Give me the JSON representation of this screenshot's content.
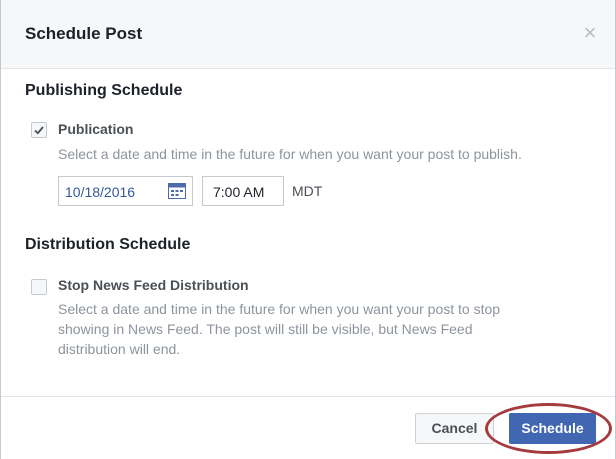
{
  "dialog": {
    "title": "Schedule Post",
    "close_glyph": "×"
  },
  "publishing": {
    "section_title": "Publishing Schedule",
    "option_label": "Publication",
    "checked": true,
    "description": "Select a date and time in the future for when you want your post to publish.",
    "date_value": "10/18/2016",
    "time_value": "7:00 AM",
    "timezone": "MDT"
  },
  "distribution": {
    "section_title": "Distribution Schedule",
    "option_label": "Stop News Feed Distribution",
    "checked": false,
    "description_line1": "Select a date and time in the future for when you want your post to stop",
    "description_line2": "showing in News Feed. The post will still be visible, but News Feed",
    "description_line3": "distribution will end."
  },
  "footer": {
    "cancel_label": "Cancel",
    "schedule_label": "Schedule"
  },
  "colors": {
    "primary": "#4267b2",
    "highlight": "#a43c3f",
    "muted_text": "#8d949e",
    "link_text": "#365899"
  }
}
